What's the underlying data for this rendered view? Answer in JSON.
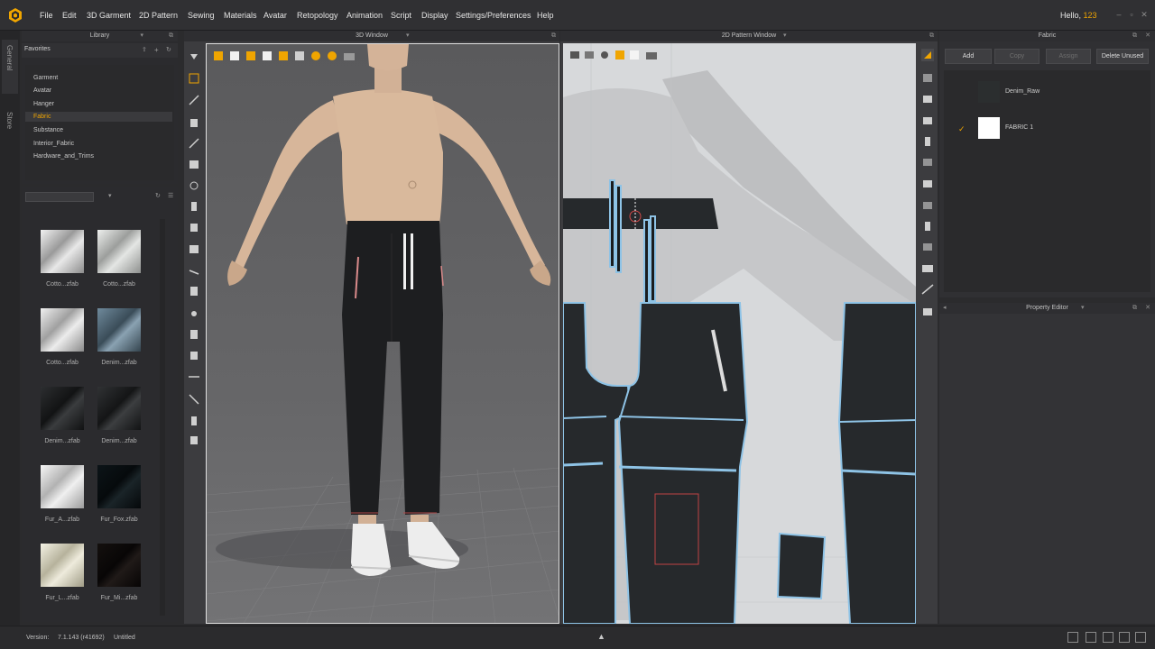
{
  "app": {
    "menu": [
      "File",
      "Edit",
      "3D Garment",
      "2D Pattern",
      "Sewing",
      "Materials",
      "Avatar",
      "Retopology",
      "Animation",
      "Script",
      "Display",
      "Settings/Preferences",
      "Help"
    ],
    "greeting": "Hello,",
    "username": "123",
    "accent": "#f0a500"
  },
  "side_tabs": [
    "General",
    "Store"
  ],
  "library": {
    "title": "Library",
    "favorites_label": "Favorites",
    "items": [
      "Garment",
      "Avatar",
      "Hanger",
      "Fabric",
      "Substance",
      "Interior_Fabric",
      "Hardware_and_Trims"
    ],
    "selected": "Fabric",
    "thumbnails": [
      {
        "label": "Cotto...zfab",
        "icon": "white-cotton-swatch"
      },
      {
        "label": "Cotto...zfab",
        "icon": "white-cotton-swatch"
      },
      {
        "label": "Cotto...zfab",
        "icon": "white-cotton-swatch"
      },
      {
        "label": "Denim...zfab",
        "icon": "blue-denim-swatch"
      },
      {
        "label": "Denim...zfab",
        "icon": "dark-denim-swatch"
      },
      {
        "label": "Denim...zfab",
        "icon": "dark-denim-swatch"
      },
      {
        "label": "Fur_A...zfab",
        "icon": "white-fur-swatch"
      },
      {
        "label": "Fur_Fox.zfab",
        "icon": "black-fur-swatch"
      },
      {
        "label": "Fur_L...zfab",
        "icon": "cream-fur-swatch"
      },
      {
        "label": "Fur_Mi...zfab",
        "icon": "black-fur-swatch"
      }
    ]
  },
  "window3d": {
    "title": "3D Window"
  },
  "window2d": {
    "title": "2D Pattern Window"
  },
  "fabric": {
    "title": "Fabric",
    "buttons": {
      "add": "Add",
      "copy": "Copy",
      "assign": "Assign",
      "delete_unused": "Delete Unused"
    },
    "items": [
      {
        "name": "Denim_Raw",
        "color": "#2b2e2f",
        "checked": false
      },
      {
        "name": "FABRIC 1",
        "color": "#ffffff",
        "checked": true
      }
    ]
  },
  "property_editor": {
    "title": "Property Editor"
  },
  "status": {
    "version_label": "Version:",
    "version": "7.1.143 (r41692)",
    "file": "Untitled"
  }
}
